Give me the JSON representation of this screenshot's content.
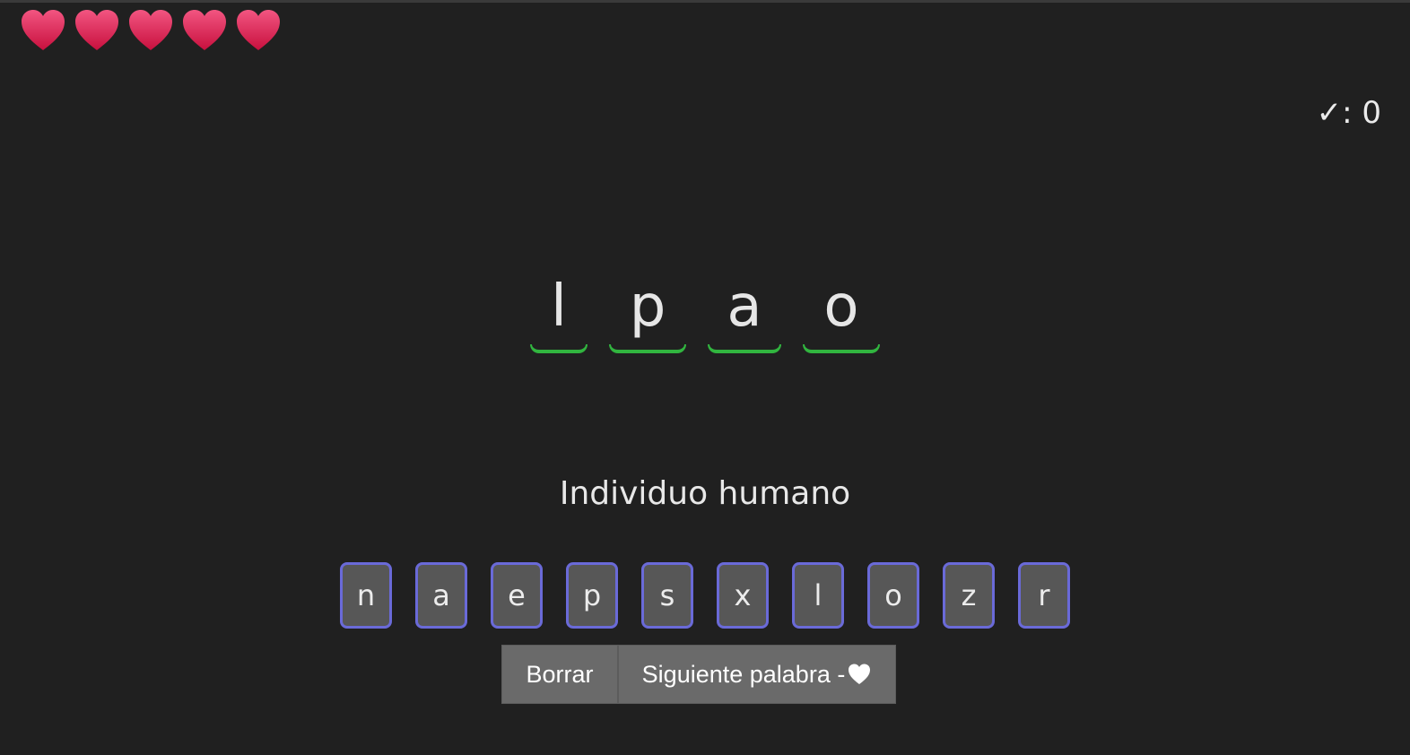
{
  "lives": {
    "count": 5,
    "icon": "heart-icon",
    "color": "#e0245e"
  },
  "score": {
    "check_glyph": "✓",
    "separator": ": ",
    "value": "0"
  },
  "word": {
    "slots": [
      "l",
      "p",
      "a",
      "o"
    ],
    "underline_color": "#31b53f"
  },
  "hint": "Individuo humano",
  "letter_bank": [
    "n",
    "a",
    "e",
    "p",
    "s",
    "x",
    "l",
    "o",
    "z",
    "r"
  ],
  "letter_border_color": "#6a6ad8",
  "actions": {
    "clear_label": "Borrar",
    "next_label": "Siguiente palabra -",
    "next_icon": "white-heart-icon"
  }
}
